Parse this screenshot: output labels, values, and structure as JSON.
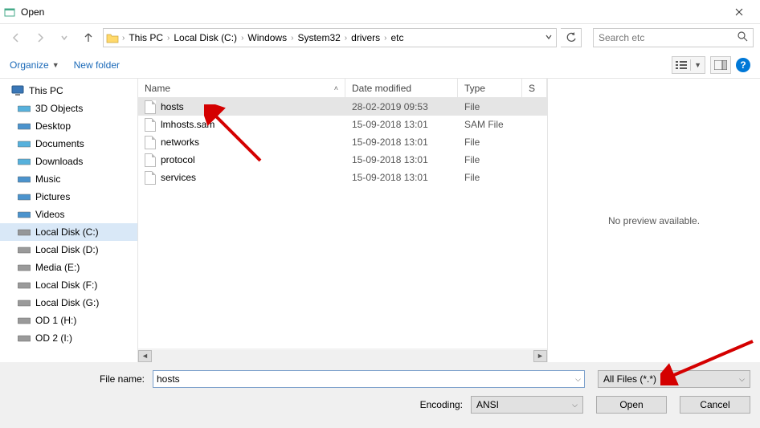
{
  "window": {
    "title": "Open"
  },
  "breadcrumb": {
    "segments": [
      "This PC",
      "Local Disk (C:)",
      "Windows",
      "System32",
      "drivers",
      "etc"
    ]
  },
  "search": {
    "placeholder": "Search etc"
  },
  "toolbar": {
    "organize": "Organize",
    "newfolder": "New folder"
  },
  "sidebar": {
    "root": "This PC",
    "items": [
      {
        "label": "3D Objects",
        "color": "#3aa3d6"
      },
      {
        "label": "Desktop",
        "color": "#2c80c4"
      },
      {
        "label": "Documents",
        "color": "#3aa3d6"
      },
      {
        "label": "Downloads",
        "color": "#3aa3d6"
      },
      {
        "label": "Music",
        "color": "#2c80c4"
      },
      {
        "label": "Pictures",
        "color": "#2c80c4"
      },
      {
        "label": "Videos",
        "color": "#2c80c4"
      },
      {
        "label": "Local Disk (C:)",
        "color": "#888",
        "selected": true
      },
      {
        "label": "Local Disk (D:)",
        "color": "#888"
      },
      {
        "label": "Media (E:)",
        "color": "#888"
      },
      {
        "label": "Local Disk (F:)",
        "color": "#888"
      },
      {
        "label": "Local Disk (G:)",
        "color": "#888"
      },
      {
        "label": "OD 1 (H:)",
        "color": "#888"
      },
      {
        "label": "OD 2 (I:)",
        "color": "#888"
      }
    ]
  },
  "columns": {
    "name": "Name",
    "date": "Date modified",
    "type": "Type",
    "size": "S"
  },
  "files": [
    {
      "name": "hosts",
      "date": "28-02-2019 09:53",
      "type": "File",
      "selected": true
    },
    {
      "name": "lmhosts.sam",
      "date": "15-09-2018 13:01",
      "type": "SAM File"
    },
    {
      "name": "networks",
      "date": "15-09-2018 13:01",
      "type": "File"
    },
    {
      "name": "protocol",
      "date": "15-09-2018 13:01",
      "type": "File"
    },
    {
      "name": "services",
      "date": "15-09-2018 13:01",
      "type": "File"
    }
  ],
  "preview": {
    "text": "No preview available."
  },
  "bottom": {
    "filename_label": "File name:",
    "filename_value": "hosts",
    "filetype_value": "All Files  (*.*)",
    "encoding_label": "Encoding:",
    "encoding_value": "ANSI",
    "open_label": "Open",
    "cancel_label": "Cancel"
  }
}
